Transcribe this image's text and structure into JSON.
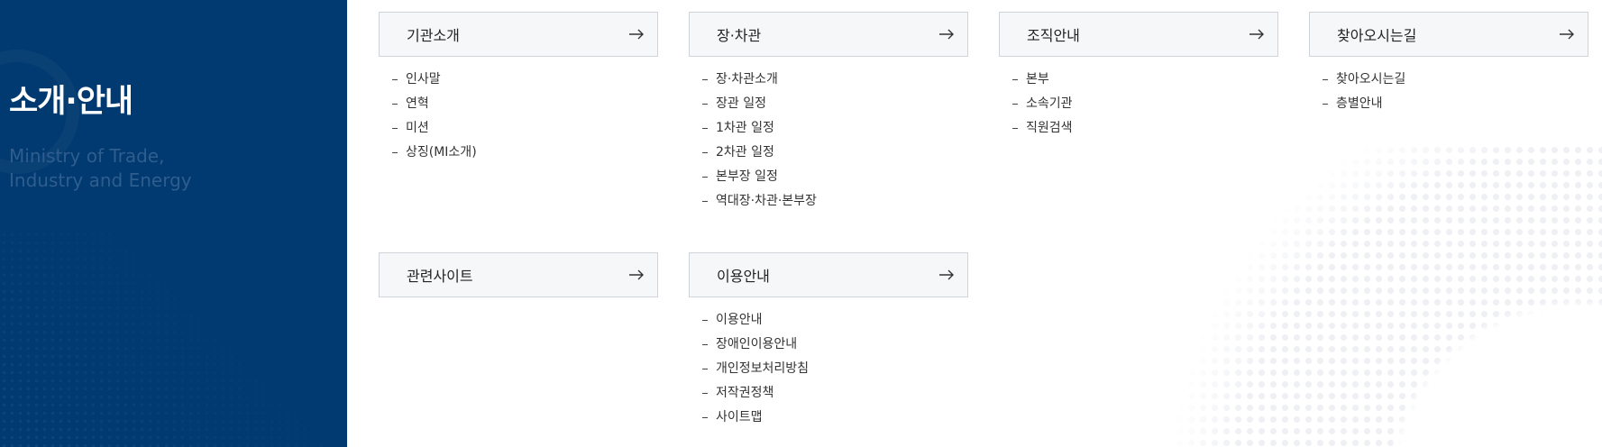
{
  "left": {
    "title": "소개·안내",
    "subtitle_line1": "Ministry of Trade,",
    "subtitle_line2": "Industry and Energy"
  },
  "sections": [
    {
      "title": "기관소개",
      "items": [
        "인사말",
        "연혁",
        "미션",
        "상징(MI소개)"
      ]
    },
    {
      "title": "장·차관",
      "items": [
        "장·차관소개",
        "장관 일정",
        "1차관 일정",
        "2차관 일정",
        "본부장 일정",
        "역대장·차관·본부장"
      ]
    },
    {
      "title": "조직안내",
      "items": [
        "본부",
        "소속기관",
        "직원검색"
      ]
    },
    {
      "title": "찾아오시는길",
      "items": [
        "찾아오시는길",
        "층별안내"
      ]
    },
    {
      "title": "관련사이트",
      "items": []
    },
    {
      "title": "이용안내",
      "items": [
        "이용안내",
        "장애인이용안내",
        "개인정보처리방침",
        "저작권정책",
        "사이트맵"
      ]
    }
  ],
  "icons": {
    "section_link": "arrow-right-icon"
  },
  "colors": {
    "panel": "#003a70",
    "header_bg": "#f6f7f9",
    "header_border": "#d0d3d9"
  }
}
